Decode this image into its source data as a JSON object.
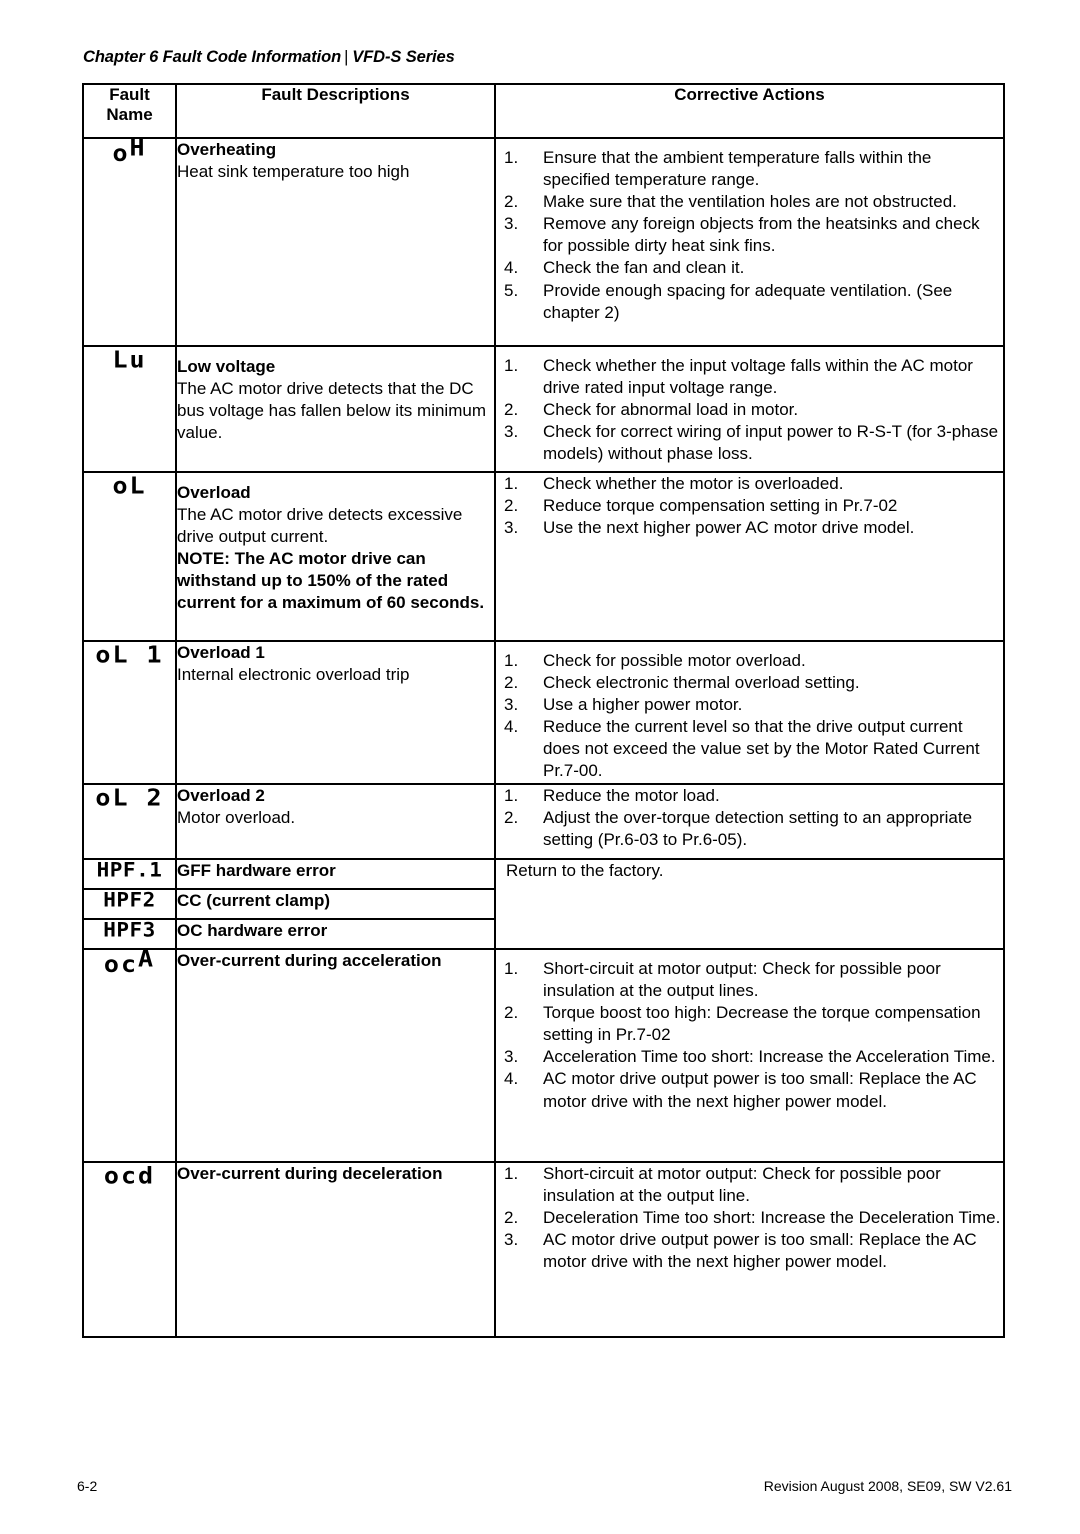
{
  "header": {
    "chapter": "Chapter 6 Fault Code Information",
    "separator": "|",
    "series": "VFD-S Series"
  },
  "table": {
    "columns": {
      "fault_name": "Fault Name",
      "fault_name_line1": "Fault",
      "fault_name_line2": "Name",
      "fault_descriptions": "Fault Descriptions",
      "corrective_actions": "Corrective Actions"
    },
    "rows": [
      {
        "code_display": "oH",
        "code_upper": "H",
        "code_lower": "o",
        "title": "Overheating",
        "body": "Heat sink temperature too high",
        "actions": [
          "Ensure that the ambient temperature falls within the specified temperature range.",
          "Make sure that the ventilation holes are not obstructed.",
          "Remove any foreign objects from the heatsinks and check for possible dirty heat sink fins.",
          "Check the fan and clean it.",
          "Provide enough spacing for adequate ventilation. (See chapter 2)"
        ]
      },
      {
        "code_display": "Lu",
        "code_upper": "",
        "code_lower": "Lu",
        "title": "Low voltage",
        "body": "The AC motor drive detects that the DC bus voltage has fallen below its minimum value.",
        "actions": [
          "Check whether the input voltage falls within the AC motor drive rated input voltage range.",
          "Check for abnormal load in motor.",
          "Check for correct wiring of input power to R-S-T (for 3-phase models) without phase loss."
        ]
      },
      {
        "code_display": "oL",
        "code_upper": "",
        "code_lower": "oL",
        "title": "Overload",
        "body": "The AC motor drive detects excessive drive output current.",
        "note": "NOTE: The AC motor drive can withstand up to 150% of the rated current for a maximum of 60 seconds.",
        "actions": [
          "Check whether the motor is overloaded.",
          "Reduce torque compensation setting in Pr.7-02",
          "Use the next higher power AC motor drive model."
        ]
      },
      {
        "code_display": "oL1",
        "code_upper": "",
        "code_lower": "oL 1",
        "title": "Overload 1",
        "body": "Internal electronic overload trip",
        "actions": [
          "Check for possible motor overload.",
          "Check electronic thermal overload setting.",
          "Use a higher power motor.",
          "Reduce the current level so that the drive output current does not exceed the value set by the Motor Rated Current Pr.7-00."
        ]
      },
      {
        "code_display": "oL2",
        "code_upper": "",
        "code_lower": "oL 2",
        "title": "Overload 2",
        "body": "Motor overload.",
        "actions": [
          "Reduce the motor load.",
          "Adjust the over-torque detection setting to an appropriate setting (Pr.6-03 to Pr.6-05)."
        ]
      },
      {
        "code_display": "HPF.1",
        "title": "GFF hardware error",
        "body": ""
      },
      {
        "code_display": "HPF2",
        "title": "CC (current clamp)",
        "body": ""
      },
      {
        "code_display": "HPF3",
        "title": "OC hardware error",
        "body": ""
      },
      {
        "code_display": "ocA",
        "code_upper": "A",
        "code_lower": "oc",
        "title": "Over-current during acceleration",
        "body": "",
        "actions": [
          "Short-circuit at motor output: Check for possible poor insulation at the output lines.",
          "Torque boost too high: Decrease the torque compensation setting in Pr.7-02",
          "Acceleration Time too short: Increase the Acceleration Time.",
          "AC motor drive output power is too small: Replace the AC motor drive with the next higher power model."
        ]
      },
      {
        "code_display": "ocd",
        "code_upper": "",
        "code_lower": "ocd",
        "title": "Over-current during deceleration",
        "body": "",
        "actions": [
          "Short-circuit at motor output: Check for possible poor insulation at the output line.",
          "Deceleration Time too short: Increase the Deceleration Time.",
          "AC motor drive output power is too small: Replace the AC motor drive with the next higher power model."
        ]
      }
    ],
    "hpf_shared_action": "Return to the factory."
  },
  "footer": {
    "page_number": "6-2",
    "revision": "Revision August 2008, SE09, SW V2.61"
  }
}
